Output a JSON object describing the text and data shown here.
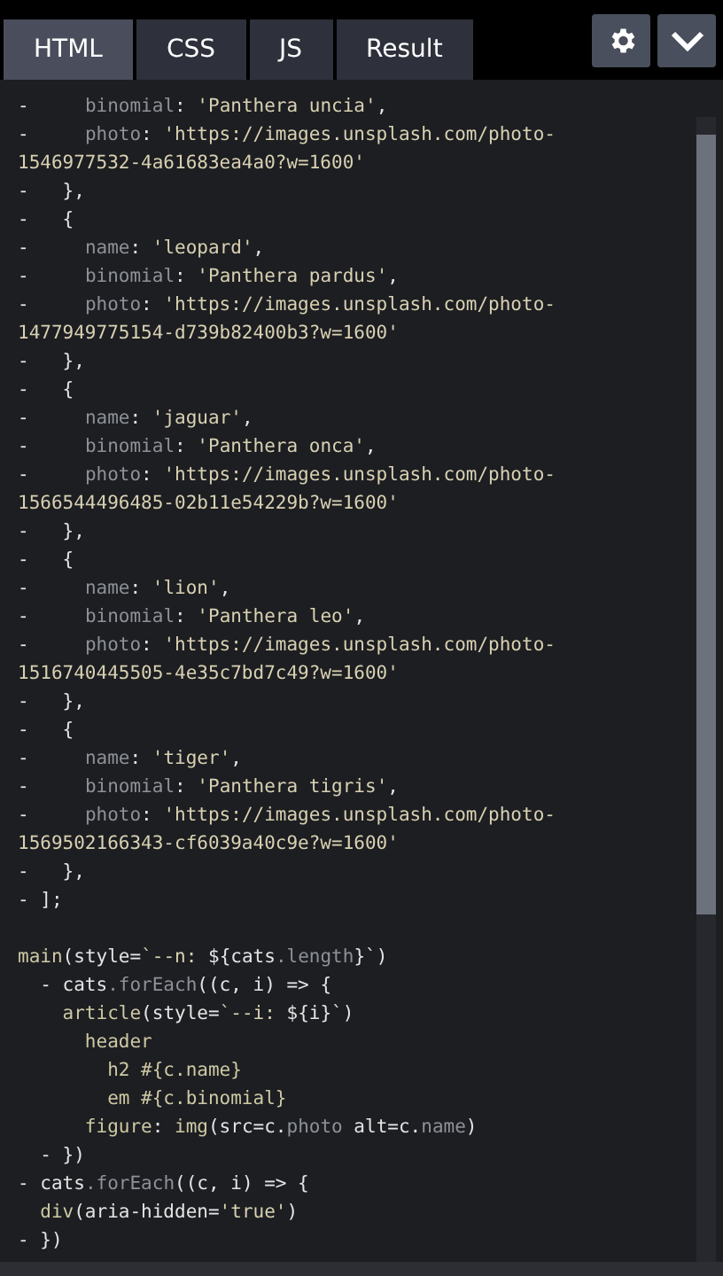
{
  "tabs": [
    {
      "label": "HTML",
      "selected": true
    },
    {
      "label": "CSS",
      "selected": false
    },
    {
      "label": "JS",
      "selected": false
    },
    {
      "label": "Result",
      "selected": false
    }
  ],
  "code_lines": [
    {
      "kind": "code",
      "tokens": [
        {
          "kind": "p",
          "text": "-     "
        },
        {
          "kind": "k",
          "text": "binomial"
        },
        {
          "kind": "p",
          "text": ": "
        },
        {
          "kind": "s",
          "text": "'Panthera uncia'"
        },
        {
          "kind": "p",
          "text": ","
        }
      ]
    },
    {
      "kind": "code",
      "tokens": [
        {
          "kind": "p",
          "text": "-     "
        },
        {
          "kind": "k",
          "text": "photo"
        },
        {
          "kind": "p",
          "text": ": "
        },
        {
          "kind": "s",
          "text": "'https://images.unsplash.com/photo-"
        }
      ]
    },
    {
      "kind": "code",
      "tokens": [
        {
          "kind": "s",
          "text": "1546977532-4a61683ea4a0?w=1600'"
        }
      ]
    },
    {
      "kind": "code",
      "tokens": [
        {
          "kind": "p",
          "text": "-   },"
        }
      ]
    },
    {
      "kind": "code",
      "tokens": [
        {
          "kind": "p",
          "text": "-   {"
        }
      ]
    },
    {
      "kind": "code",
      "tokens": [
        {
          "kind": "p",
          "text": "-     "
        },
        {
          "kind": "k",
          "text": "name"
        },
        {
          "kind": "p",
          "text": ": "
        },
        {
          "kind": "s",
          "text": "'leopard'"
        },
        {
          "kind": "p",
          "text": ","
        }
      ]
    },
    {
      "kind": "code",
      "tokens": [
        {
          "kind": "p",
          "text": "-     "
        },
        {
          "kind": "k",
          "text": "binomial"
        },
        {
          "kind": "p",
          "text": ": "
        },
        {
          "kind": "s",
          "text": "'Panthera pardus'"
        },
        {
          "kind": "p",
          "text": ","
        }
      ]
    },
    {
      "kind": "code",
      "tokens": [
        {
          "kind": "p",
          "text": "-     "
        },
        {
          "kind": "k",
          "text": "photo"
        },
        {
          "kind": "p",
          "text": ": "
        },
        {
          "kind": "s",
          "text": "'https://images.unsplash.com/photo-"
        }
      ]
    },
    {
      "kind": "code",
      "tokens": [
        {
          "kind": "s",
          "text": "1477949775154-d739b82400b3?w=1600'"
        }
      ]
    },
    {
      "kind": "code",
      "tokens": [
        {
          "kind": "p",
          "text": "-   },"
        }
      ]
    },
    {
      "kind": "code",
      "tokens": [
        {
          "kind": "p",
          "text": "-   {"
        }
      ]
    },
    {
      "kind": "code",
      "tokens": [
        {
          "kind": "p",
          "text": "-     "
        },
        {
          "kind": "k",
          "text": "name"
        },
        {
          "kind": "p",
          "text": ": "
        },
        {
          "kind": "s",
          "text": "'jaguar'"
        },
        {
          "kind": "p",
          "text": ","
        }
      ]
    },
    {
      "kind": "code",
      "tokens": [
        {
          "kind": "p",
          "text": "-     "
        },
        {
          "kind": "k",
          "text": "binomial"
        },
        {
          "kind": "p",
          "text": ": "
        },
        {
          "kind": "s",
          "text": "'Panthera onca'"
        },
        {
          "kind": "p",
          "text": ","
        }
      ]
    },
    {
      "kind": "code",
      "tokens": [
        {
          "kind": "p",
          "text": "-     "
        },
        {
          "kind": "k",
          "text": "photo"
        },
        {
          "kind": "p",
          "text": ": "
        },
        {
          "kind": "s",
          "text": "'https://images.unsplash.com/photo-"
        }
      ]
    },
    {
      "kind": "code",
      "tokens": [
        {
          "kind": "s",
          "text": "1566544496485-02b11e54229b?w=1600'"
        }
      ]
    },
    {
      "kind": "code",
      "tokens": [
        {
          "kind": "p",
          "text": "-   },"
        }
      ]
    },
    {
      "kind": "code",
      "tokens": [
        {
          "kind": "p",
          "text": "-   {"
        }
      ]
    },
    {
      "kind": "code",
      "tokens": [
        {
          "kind": "p",
          "text": "-     "
        },
        {
          "kind": "k",
          "text": "name"
        },
        {
          "kind": "p",
          "text": ": "
        },
        {
          "kind": "s",
          "text": "'lion'"
        },
        {
          "kind": "p",
          "text": ","
        }
      ]
    },
    {
      "kind": "code",
      "tokens": [
        {
          "kind": "p",
          "text": "-     "
        },
        {
          "kind": "k",
          "text": "binomial"
        },
        {
          "kind": "p",
          "text": ": "
        },
        {
          "kind": "s",
          "text": "'Panthera leo'"
        },
        {
          "kind": "p",
          "text": ","
        }
      ]
    },
    {
      "kind": "code",
      "tokens": [
        {
          "kind": "p",
          "text": "-     "
        },
        {
          "kind": "k",
          "text": "photo"
        },
        {
          "kind": "p",
          "text": ": "
        },
        {
          "kind": "s",
          "text": "'https://images.unsplash.com/photo-"
        }
      ]
    },
    {
      "kind": "code",
      "tokens": [
        {
          "kind": "s",
          "text": "1516740445505-4e35c7bd7c49?w=1600'"
        }
      ]
    },
    {
      "kind": "code",
      "tokens": [
        {
          "kind": "p",
          "text": "-   },"
        }
      ]
    },
    {
      "kind": "code",
      "tokens": [
        {
          "kind": "p",
          "text": "-   {"
        }
      ]
    },
    {
      "kind": "code",
      "tokens": [
        {
          "kind": "p",
          "text": "-     "
        },
        {
          "kind": "k",
          "text": "name"
        },
        {
          "kind": "p",
          "text": ": "
        },
        {
          "kind": "s",
          "text": "'tiger'"
        },
        {
          "kind": "p",
          "text": ","
        }
      ]
    },
    {
      "kind": "code",
      "tokens": [
        {
          "kind": "p",
          "text": "-     "
        },
        {
          "kind": "k",
          "text": "binomial"
        },
        {
          "kind": "p",
          "text": ": "
        },
        {
          "kind": "s",
          "text": "'Panthera tigris'"
        },
        {
          "kind": "p",
          "text": ","
        }
      ]
    },
    {
      "kind": "code",
      "tokens": [
        {
          "kind": "p",
          "text": "-     "
        },
        {
          "kind": "k",
          "text": "photo"
        },
        {
          "kind": "p",
          "text": ": "
        },
        {
          "kind": "s",
          "text": "'https://images.unsplash.com/photo-"
        }
      ]
    },
    {
      "kind": "code",
      "tokens": [
        {
          "kind": "s",
          "text": "1569502166343-cf6039a40c9e?w=1600'"
        }
      ]
    },
    {
      "kind": "code",
      "tokens": [
        {
          "kind": "p",
          "text": "-   },"
        }
      ]
    },
    {
      "kind": "code",
      "tokens": [
        {
          "kind": "p",
          "text": "- ];"
        }
      ]
    },
    {
      "kind": "blank"
    },
    {
      "kind": "code",
      "tokens": [
        {
          "kind": "t",
          "text": "main"
        },
        {
          "kind": "p",
          "text": "(style="
        },
        {
          "kind": "s",
          "text": "`--n: "
        },
        {
          "kind": "p",
          "text": "${cats"
        },
        {
          "kind": "k",
          "text": ".length"
        },
        {
          "kind": "p",
          "text": "}`)"
        }
      ]
    },
    {
      "kind": "code",
      "tokens": [
        {
          "kind": "p",
          "text": "  - cats"
        },
        {
          "kind": "k",
          "text": ".forEach"
        },
        {
          "kind": "p",
          "text": "((c, i) => {"
        }
      ]
    },
    {
      "kind": "code",
      "tokens": [
        {
          "kind": "t",
          "text": "    article"
        },
        {
          "kind": "p",
          "text": "(style="
        },
        {
          "kind": "s",
          "text": "`--i: "
        },
        {
          "kind": "p",
          "text": "${i}`)"
        }
      ]
    },
    {
      "kind": "code",
      "tokens": [
        {
          "kind": "t",
          "text": "      header"
        }
      ]
    },
    {
      "kind": "code",
      "tokens": [
        {
          "kind": "t",
          "text": "        h2 #{c.name}"
        }
      ]
    },
    {
      "kind": "code",
      "tokens": [
        {
          "kind": "t",
          "text": "        em #{c.binomial}"
        }
      ]
    },
    {
      "kind": "code",
      "tokens": [
        {
          "kind": "t",
          "text": "      figure"
        },
        {
          "kind": "p",
          "text": ": "
        },
        {
          "kind": "t",
          "text": "img"
        },
        {
          "kind": "p",
          "text": "(src=c."
        },
        {
          "kind": "k",
          "text": "photo"
        },
        {
          "kind": "p",
          "text": " alt=c."
        },
        {
          "kind": "k",
          "text": "name"
        },
        {
          "kind": "p",
          "text": ")"
        }
      ]
    },
    {
      "kind": "code",
      "tokens": [
        {
          "kind": "p",
          "text": "  - })"
        }
      ]
    },
    {
      "kind": "code",
      "tokens": [
        {
          "kind": "p",
          "text": "- cats"
        },
        {
          "kind": "k",
          "text": ".forEach"
        },
        {
          "kind": "p",
          "text": "((c, i) => {"
        }
      ]
    },
    {
      "kind": "code",
      "tokens": [
        {
          "kind": "t",
          "text": "  div"
        },
        {
          "kind": "p",
          "text": "(aria-hidden="
        },
        {
          "kind": "s",
          "text": "'true'"
        },
        {
          "kind": "p",
          "text": ")"
        }
      ]
    },
    {
      "kind": "code",
      "tokens": [
        {
          "kind": "p",
          "text": "- })"
        }
      ]
    }
  ]
}
